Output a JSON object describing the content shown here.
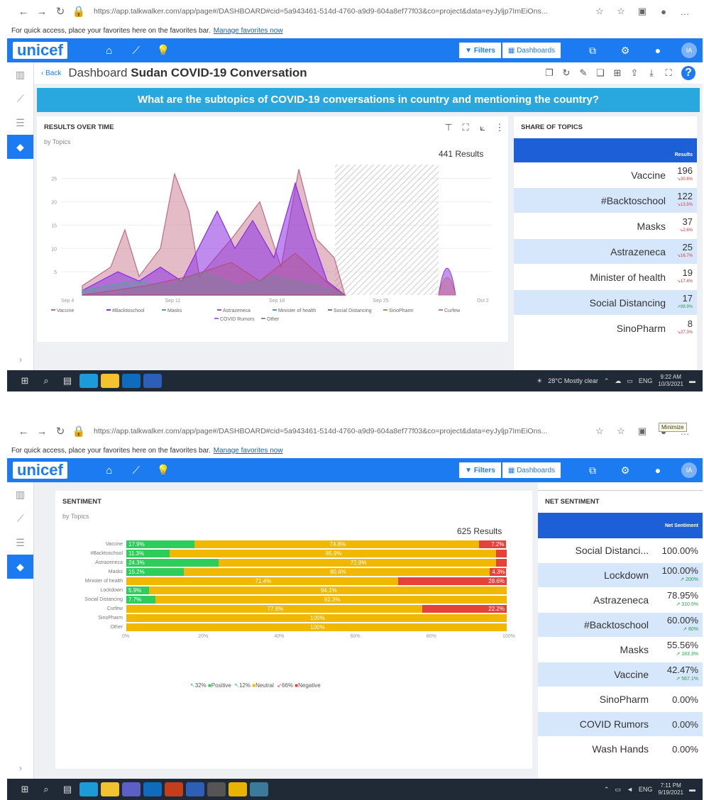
{
  "shot1": {
    "browser": {
      "url": "https://app.talkwalker.com/app/page#/DASHBOARD#cid=5a943461-514d-4760-a9d9-604a8ef77f03&co=project&data=eyJyljp7ImEiOns...",
      "favorites_text": "For quick access, place your favorites here on the favorites bar.",
      "favorites_link": "Manage favorites now"
    },
    "topnav": {
      "logo": "unicef",
      "filters_label": "Filters",
      "dashboards_label": "Dashboards",
      "avatar": "IA"
    },
    "dashboard": {
      "back_label": "Back",
      "title_prefix": "Dashboard",
      "title": "Sudan COVID-19 Conversation",
      "banner": "What are the subtopics of COVID-19 conversations in country and mentioning the country?"
    },
    "results_over_time": {
      "title": "RESULTS OVER TIME",
      "subtitle": "by Topics",
      "results": "441 Results",
      "y_ticks": [
        "25",
        "20",
        "15",
        "10",
        "5"
      ],
      "x_ticks": [
        "Sep 4",
        "Sep 11",
        "Sep 18",
        "Sep 25",
        "Oct 2"
      ],
      "legend": [
        "Vaccine",
        "#Backtoschool",
        "Masks",
        "Astrazeneca",
        "Minister of health",
        "Social Distancing",
        "SinoPharm",
        "Curfew",
        "COVID Rumors",
        "Other"
      ]
    },
    "share_of_topics": {
      "title": "SHARE OF TOPICS",
      "header": "Results",
      "rows": [
        {
          "name": "Vaccine",
          "value": "196",
          "change": "30.6%",
          "dir": "down"
        },
        {
          "name": "#Backtoschool",
          "value": "122",
          "change": "13.5%",
          "dir": "down"
        },
        {
          "name": "Masks",
          "value": "37",
          "change": "2.6%",
          "dir": "down"
        },
        {
          "name": "Astrazeneca",
          "value": "25",
          "change": "16.7%",
          "dir": "down"
        },
        {
          "name": "Minister of health",
          "value": "19",
          "change": "17.4%",
          "dir": "down"
        },
        {
          "name": "Social Distancing",
          "value": "17",
          "change": "88.9%",
          "dir": "up"
        },
        {
          "name": "SinoPharm",
          "value": "8",
          "change": "27.3%",
          "dir": "down"
        }
      ]
    },
    "taskbar": {
      "weather": "28°C  Mostly clear",
      "lang": "ENG",
      "time": "9:22 AM",
      "date": "10/3/2021"
    }
  },
  "shot2": {
    "browser": {
      "url": "https://app.talkwalker.com/app/page#/DASHBOARD#cid=5a943461-514d-4760-a9d9-604a8ef77f03&co=project&data=eyJyljp7ImEiOns...",
      "favorites_text": "For quick access, place your favorites here on the favorites bar.",
      "favorites_link": "Manage favorites now",
      "tooltip": "Minimize"
    },
    "topnav": {
      "logo": "unicef",
      "filters_label": "Filters",
      "dashboards_label": "Dashboards",
      "avatar": "IA"
    },
    "sentiment": {
      "title": "SENTIMENT",
      "subtitle": "by Topics",
      "results": "625 Results",
      "x_ticks": [
        "0%",
        "20%",
        "40%",
        "60%",
        "80%",
        "100%"
      ],
      "legend": {
        "pos_change": "32%",
        "pos_label": "Positive",
        "neu_change": "12%",
        "neu_label": "Neutral",
        "neg_change": "66%",
        "neg_label": "Negative"
      }
    },
    "net_sentiment": {
      "title": "NET SENTIMENT",
      "header": "Net Sentiment",
      "rows": [
        {
          "name": "Social Distanci...",
          "value": "100.00%",
          "change": ""
        },
        {
          "name": "Lockdown",
          "value": "100.00%",
          "change": "200%"
        },
        {
          "name": "Astrazeneca",
          "value": "78.95%",
          "change": "310.5%"
        },
        {
          "name": "#Backtoschool",
          "value": "60.00%",
          "change": "80%"
        },
        {
          "name": "Masks",
          "value": "55.56%",
          "change": "183.3%"
        },
        {
          "name": "Vaccine",
          "value": "42.47%",
          "change": "567.1%"
        },
        {
          "name": "SinoPharm",
          "value": "0.00%",
          "change": ""
        },
        {
          "name": "COVID Rumors",
          "value": "0.00%",
          "change": ""
        },
        {
          "name": "Wash Hands",
          "value": "0.00%",
          "change": ""
        }
      ]
    },
    "taskbar": {
      "lang": "ENG",
      "time": "7:11 PM",
      "date": "9/19/2021"
    }
  },
  "chart_data": [
    {
      "type": "area",
      "title": "RESULTS OVER TIME",
      "subtitle": "by Topics",
      "xlabel": "",
      "ylabel": "",
      "ylim": [
        0,
        28
      ],
      "x": [
        "Sep 4",
        "Sep 11",
        "Sep 18",
        "Sep 25",
        "Oct 2"
      ],
      "series": [
        {
          "name": "Vaccine",
          "color": "#c06a86"
        },
        {
          "name": "#Backtoschool",
          "color": "#8a2be2"
        },
        {
          "name": "Masks",
          "color": "#5aa0a0"
        },
        {
          "name": "Astrazeneca",
          "color": "#b05080"
        },
        {
          "name": "Minister of health",
          "color": "#3aa0c0"
        },
        {
          "name": "Social Distancing",
          "color": "#7a7a7a"
        },
        {
          "name": "SinoPharm",
          "color": "#9a9a50"
        },
        {
          "name": "Curfew",
          "color": "#d07090"
        },
        {
          "name": "COVID Rumors",
          "color": "#a070d0"
        },
        {
          "name": "Other",
          "color": "#909090"
        }
      ]
    },
    {
      "type": "bar",
      "title": "SENTIMENT",
      "subtitle": "by Topics",
      "categories": [
        "Vaccine",
        "#Backtoschool",
        "Astrazeneca",
        "Masks",
        "Minister of health",
        "Lockdown",
        "Social Distancing",
        "Curfew",
        "SinoPharm",
        "Other"
      ],
      "series": [
        {
          "name": "Positive",
          "color": "#2ecc5a",
          "values": [
            17.9,
            11.3,
            24.3,
            15.2,
            0,
            5.9,
            7.7,
            0,
            0,
            0
          ]
        },
        {
          "name": "Neutral",
          "color": "#f0b800",
          "values": [
            74.8,
            85.9,
            72.9,
            80.4,
            71.4,
            94.1,
            92.3,
            77.8,
            100,
            100
          ]
        },
        {
          "name": "Negative",
          "color": "#e5433a",
          "values": [
            7.2,
            2.8,
            2.8,
            4.3,
            28.6,
            0,
            0,
            22.2,
            0,
            0
          ]
        }
      ],
      "labels": {
        "Positive": [
          "17.9%",
          "11.3%",
          "24.3%",
          "15.2%",
          "",
          "5.9%",
          "7.7%",
          "",
          "",
          ""
        ],
        "Neutral": [
          "74.8%",
          "85.9%",
          "72.9%",
          "80.4%",
          "71.4%",
          "94.1%",
          "92.3%",
          "77.8%",
          "100%",
          "100%"
        ],
        "Negative": [
          "7.2%",
          "",
          "",
          "4.3%",
          "28.6%",
          "",
          "",
          "22.2%",
          "",
          ""
        ]
      },
      "xlim": [
        0,
        100
      ]
    }
  ],
  "colors": {
    "accent": "#1c7bf0",
    "banner": "#29a8e0",
    "table_header": "#1c5fd6",
    "row_alt": "#d6e6fb",
    "positive": "#2ecc5a",
    "neutral": "#f0b800",
    "negative": "#e5433a"
  }
}
